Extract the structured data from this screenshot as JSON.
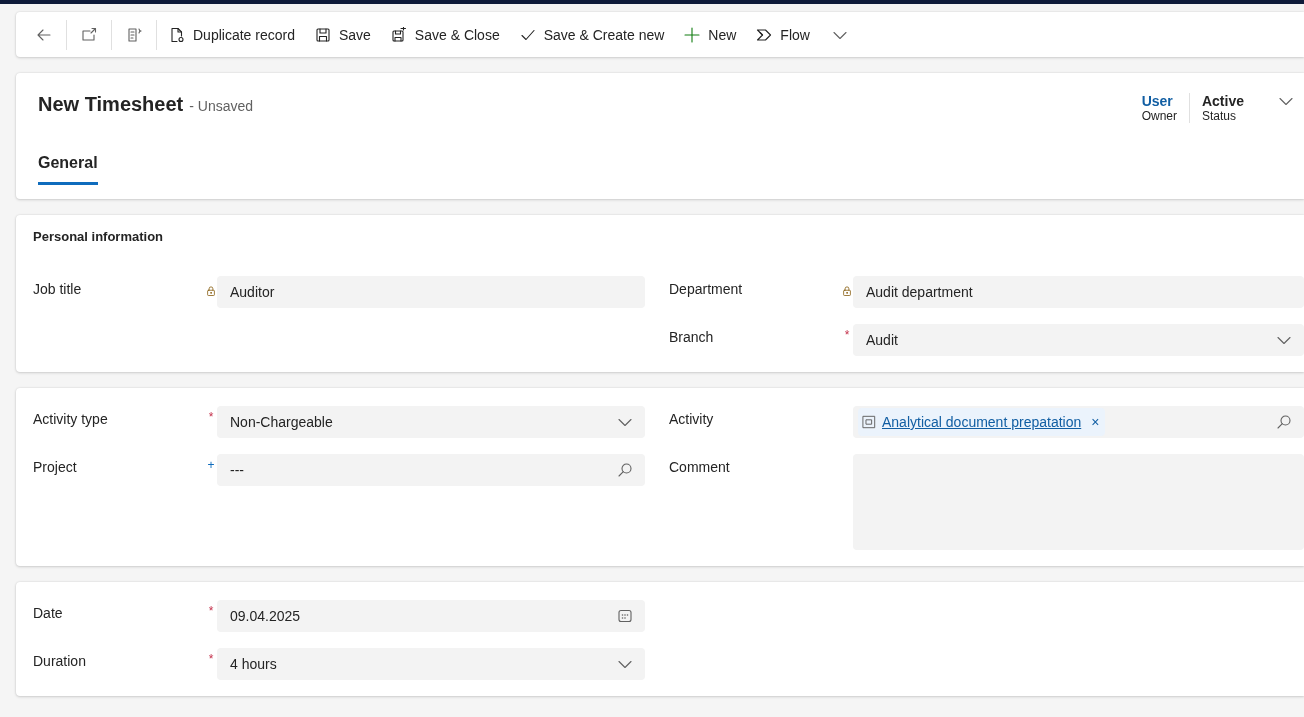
{
  "toolbar": {
    "items": [
      {
        "kind": "duplicate",
        "label": "Duplicate record"
      },
      {
        "kind": "save",
        "label": "Save"
      },
      {
        "kind": "save_close",
        "label": "Save & Close"
      },
      {
        "kind": "save_new",
        "label": "Save & Create new"
      },
      {
        "kind": "new",
        "label": "New"
      },
      {
        "kind": "flow",
        "label": "Flow"
      }
    ]
  },
  "header": {
    "title": "New Timesheet",
    "save_state": "- Unsaved",
    "fields": [
      {
        "value": "User",
        "label": "Owner",
        "kind": "link"
      },
      {
        "value": "Active",
        "label": "Status",
        "kind": "text"
      }
    ],
    "tabs": [
      {
        "label": "General",
        "selected": true
      }
    ]
  },
  "sections": [
    {
      "title": "Personal information",
      "left": [
        {
          "label": "Job title",
          "kind": "locked",
          "value": "Auditor"
        }
      ],
      "right": [
        {
          "label": "Department",
          "kind": "locked",
          "value": "Audit department"
        },
        {
          "label": "Branch",
          "kind": "select",
          "marker": {
            "kind": "required",
            "symbol": "*"
          },
          "value": "Audit"
        }
      ]
    },
    {
      "left": [
        {
          "label": "Activity type",
          "kind": "select",
          "marker": {
            "kind": "required",
            "symbol": "*"
          },
          "value": "Non-Chargeable"
        },
        {
          "label": "Project",
          "kind": "lookup",
          "marker": {
            "kind": "recommended",
            "symbol": "+"
          },
          "value": "---"
        }
      ],
      "right": [
        {
          "label": "Activity",
          "kind": "lookup",
          "tag": "Analytical document prepatation",
          "remove": "×"
        },
        {
          "label": "Comment",
          "kind": "textarea"
        }
      ]
    },
    {
      "left": [
        {
          "label": "Date",
          "kind": "date",
          "marker": {
            "kind": "required",
            "symbol": "*"
          },
          "value": "09.04.2025"
        },
        {
          "label": "Duration",
          "kind": "select",
          "marker": {
            "kind": "required",
            "symbol": "*"
          },
          "value": "4 hours"
        }
      ]
    }
  ]
}
